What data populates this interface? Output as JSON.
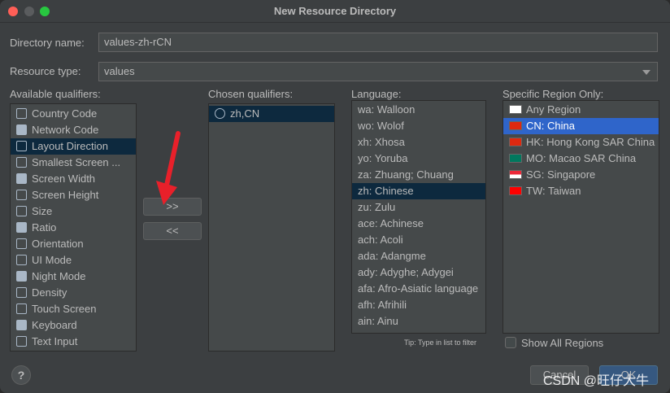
{
  "window": {
    "title": "New Resource Directory"
  },
  "form": {
    "directory_name_label": "Directory name:",
    "directory_name_value": "values-zh-rCN",
    "resource_type_label": "Resource type:",
    "resource_type_value": "values"
  },
  "available": {
    "label": "Available qualifiers:",
    "items": [
      {
        "label": "Country Code",
        "icon": "country-code-icon"
      },
      {
        "label": "Network Code",
        "icon": "network-code-icon"
      },
      {
        "label": "Layout Direction",
        "icon": "layout-direction-icon",
        "selected": true
      },
      {
        "label": "Smallest Screen ...",
        "icon": "smallest-screen-icon"
      },
      {
        "label": "Screen Width",
        "icon": "screen-width-icon"
      },
      {
        "label": "Screen Height",
        "icon": "screen-height-icon"
      },
      {
        "label": "Size",
        "icon": "size-icon"
      },
      {
        "label": "Ratio",
        "icon": "ratio-icon"
      },
      {
        "label": "Orientation",
        "icon": "orientation-icon"
      },
      {
        "label": "UI Mode",
        "icon": "ui-mode-icon"
      },
      {
        "label": "Night Mode",
        "icon": "night-mode-icon"
      },
      {
        "label": "Density",
        "icon": "density-icon"
      },
      {
        "label": "Touch Screen",
        "icon": "touch-screen-icon"
      },
      {
        "label": "Keyboard",
        "icon": "keyboard-icon"
      },
      {
        "label": "Text Input",
        "icon": "text-input-icon"
      }
    ]
  },
  "buttons": {
    "add": ">>",
    "remove": "<<",
    "help": "?",
    "cancel": "Cancel",
    "ok": "OK"
  },
  "chosen": {
    "label": "Chosen qualifiers:",
    "items": [
      {
        "label": "zh,CN",
        "icon": "globe-icon"
      }
    ]
  },
  "language": {
    "label": "Language:",
    "items": [
      "wa: Walloon",
      "wo: Wolof",
      "xh: Xhosa",
      "yo: Yoruba",
      "za: Zhuang; Chuang",
      "zh: Chinese",
      "zu: Zulu",
      "ace: Achinese",
      "ach: Acoli",
      "ada: Adangme",
      "ady: Adyghe; Adygei",
      "afa: Afro-Asiatic language",
      "afh: Afrihili",
      "ain: Ainu"
    ],
    "selected_index": 5,
    "tip": "Tip: Type in list to filter"
  },
  "region": {
    "label": "Specific Region Only:",
    "items": [
      {
        "label": "Any Region",
        "flag": "blank"
      },
      {
        "label": "CN: China",
        "flag": "cn"
      },
      {
        "label": "HK: Hong Kong SAR China",
        "flag": "hk"
      },
      {
        "label": "MO: Macao SAR China",
        "flag": "mo"
      },
      {
        "label": "SG: Singapore",
        "flag": "sg"
      },
      {
        "label": "TW: Taiwan",
        "flag": "tw"
      }
    ],
    "selected_index": 1,
    "show_all_label": "Show All Regions",
    "show_all_checked": false
  },
  "colors": {
    "accent": "#2f65ca",
    "dark_selection": "#0d293e",
    "arrow": "#e8202a"
  },
  "watermark": "CSDN @旺仔大牛"
}
